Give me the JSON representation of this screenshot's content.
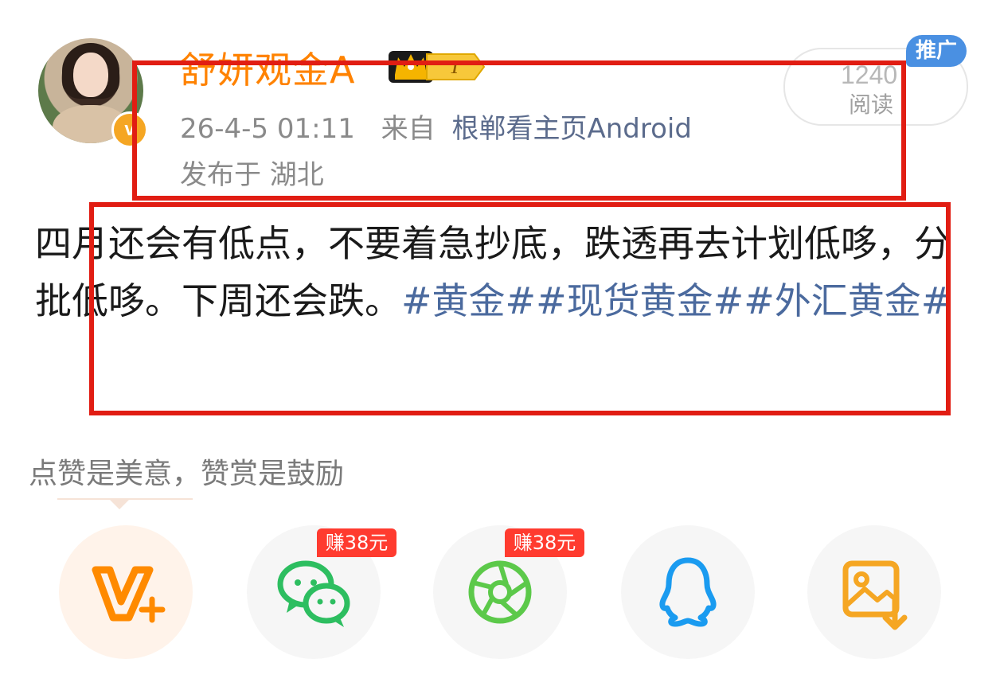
{
  "author": {
    "name": "舒妍观金A",
    "verified_icon": "v-badge-icon",
    "crown_icon": "crown-icon",
    "rank_icon": "rank-pill-icon"
  },
  "meta": {
    "timestamp": "26-4-5 01:11",
    "source_prefix": "来自",
    "source": "根郸看主页Android",
    "location": "发布于 湖北"
  },
  "read_pill": {
    "count": "1240",
    "label": "阅读",
    "promo_tag": "推广"
  },
  "post": {
    "text": "四月还会有低点，不要着急抄底，跌透再去计划低哆，分批低哆。下周还会跌。",
    "hashtags": [
      "#黄金#",
      "#现货黄金#",
      "#外汇黄金#"
    ]
  },
  "praise_caption": "点赞是美意，赞赏是鼓励",
  "share_buttons": [
    {
      "name": "reward-v-plus",
      "icon": "v-plus-icon",
      "badge": ""
    },
    {
      "name": "share-wechat",
      "icon": "wechat-icon",
      "badge": "赚38元"
    },
    {
      "name": "share-moments",
      "icon": "moments-icon",
      "badge": "赚38元"
    },
    {
      "name": "share-qq",
      "icon": "qq-icon",
      "badge": ""
    },
    {
      "name": "save-image",
      "icon": "save-image-icon",
      "badge": ""
    }
  ],
  "colors": {
    "username": "#ff8200",
    "hashtag": "#4b6a9e",
    "highlight_box": "#e11d13",
    "earn_badge": "#ff3b2f",
    "promo": "#4a90e2"
  }
}
